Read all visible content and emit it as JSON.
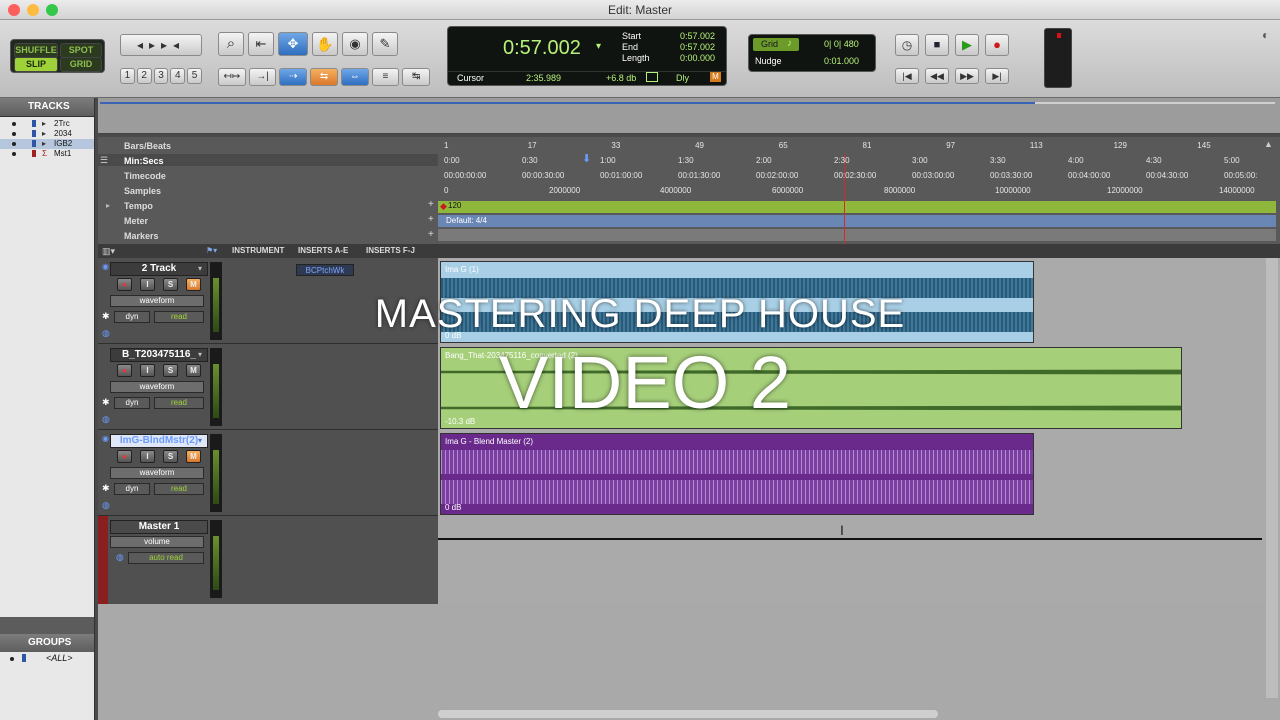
{
  "window": {
    "title": "Edit: Master"
  },
  "toolbar": {
    "modes": {
      "shuffle": "SHUFFLE",
      "spot": "SPOT",
      "slip": "SLIP",
      "grid": "GRID"
    },
    "zoom_presets": [
      "1",
      "2",
      "3",
      "4",
      "5"
    ],
    "counter": {
      "main": "0:57.002",
      "start_label": "Start",
      "end_label": "End",
      "length_label": "Length",
      "start": "0:57.002",
      "end": "0:57.002",
      "length": "0:00.000",
      "cursor_label": "Cursor",
      "cursor": "2:35.989",
      "level": "+6.8 db",
      "dly": "Dly"
    },
    "grid": {
      "label": "Grid",
      "value": "0| 0| 480"
    },
    "nudge": {
      "label": "Nudge",
      "value": "0:01.000"
    }
  },
  "tracks_panel": {
    "title": "TRACKS",
    "items": [
      {
        "name": "2Trc"
      },
      {
        "name": "2034"
      },
      {
        "name": "IGB2"
      },
      {
        "name": "Mst1"
      }
    ]
  },
  "groups_panel": {
    "title": "GROUPS",
    "all": "<ALL>"
  },
  "rulers": {
    "names": {
      "bars": "Bars/Beats",
      "minsecs": "Min:Secs",
      "timecode": "Timecode",
      "samples": "Samples",
      "tempo": "Tempo",
      "meter": "Meter",
      "markers": "Markers"
    },
    "bars": [
      "1",
      "17",
      "33",
      "49",
      "65",
      "81",
      "97",
      "113",
      "129",
      "145"
    ],
    "minsecs": [
      "0:00",
      "0:30",
      "1:00",
      "1:30",
      "2:00",
      "2:30",
      "3:00",
      "3:30",
      "4:00",
      "4:30",
      "5:00"
    ],
    "timecode": [
      "00:00:00:00",
      "00:00:30:00",
      "00:01:00:00",
      "00:01:30:00",
      "00:02:00:00",
      "00:02:30:00",
      "00:03:00:00",
      "00:03:30:00",
      "00:04:00:00",
      "00:04:30:00",
      "00:05:00:"
    ],
    "samples": [
      "0",
      "2000000",
      "4000000",
      "6000000",
      "8000000",
      "10000000",
      "12000000",
      "14000000"
    ],
    "tempo_value": "120",
    "meter_value": "Default: 4/4"
  },
  "columns": {
    "instrument": "INSTRUMENT",
    "inserts_ae": "INSERTS A-E",
    "inserts_fj": "INSERTS F-J"
  },
  "tracks": [
    {
      "name": "2 Track",
      "view": "waveform",
      "dyn": "dyn",
      "auto": "read",
      "insert": "BCPtchWk",
      "clip_name": "Ima G (1)",
      "clip_level": "0 dB",
      "color": "#7fb7d9"
    },
    {
      "name": "B_T203475116_",
      "view": "waveform",
      "dyn": "dyn",
      "auto": "read",
      "insert": "",
      "clip_name": "Bang_That-203475116_converted (2)",
      "clip_level": "-10.3 dB",
      "color": "#a6cf7a"
    },
    {
      "name": "ImG-BlndMstr(2)",
      "view": "waveform",
      "dyn": "dyn",
      "auto": "read",
      "insert": "",
      "clip_name": "Ima G - Blend Master (2)",
      "clip_level": "0 dB",
      "color": "#6a2a8c"
    },
    {
      "name": "Master 1",
      "view": "volume",
      "dyn": "",
      "auto": "auto read",
      "insert": "",
      "clip_name": "",
      "clip_level": "",
      "color": "#9a2020"
    }
  ],
  "track_buttons": {
    "rec": "●",
    "input": "I",
    "solo": "S",
    "mute": "M"
  },
  "overlay": {
    "line1": "MASTERING DEEP HOUSE",
    "line2": "VIDEO 2"
  }
}
